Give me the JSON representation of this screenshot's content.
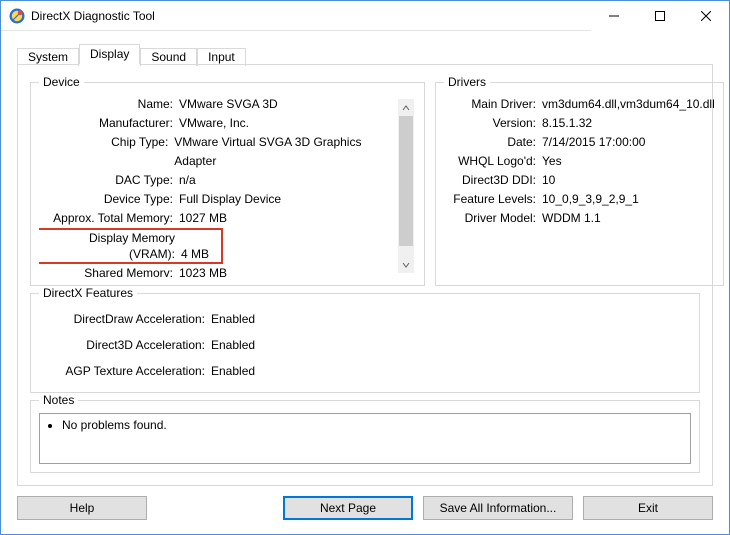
{
  "window": {
    "title": "DirectX Diagnostic Tool"
  },
  "tabs": {
    "system": "System",
    "display": "Display",
    "sound": "Sound",
    "input": "Input",
    "active": "display"
  },
  "groups": {
    "device": "Device",
    "drivers": "Drivers",
    "dxfeat": "DirectX Features",
    "notes": "Notes"
  },
  "device": {
    "name_k": "Name:",
    "name_v": "VMware SVGA 3D",
    "manufacturer_k": "Manufacturer:",
    "manufacturer_v": "VMware, Inc.",
    "chip_k": "Chip Type:",
    "chip_v": "VMware Virtual SVGA 3D Graphics Adapter",
    "dac_k": "DAC Type:",
    "dac_v": "n/a",
    "devtype_k": "Device Type:",
    "devtype_v": "Full Display Device",
    "totmem_k": "Approx. Total Memory:",
    "totmem_v": "1027 MB",
    "vram_k": "Display Memory (VRAM):",
    "vram_v": "4 MB",
    "shmem_k": "Shared Memory:",
    "shmem_v": "1023 MB"
  },
  "drivers": {
    "main_k": "Main Driver:",
    "main_v": "vm3dum64.dll,vm3dum64_10.dll",
    "ver_k": "Version:",
    "ver_v": "8.15.1.32",
    "date_k": "Date:",
    "date_v": "7/14/2015 17:00:00",
    "whql_k": "WHQL Logo'd:",
    "whql_v": "Yes",
    "ddi_k": "Direct3D DDI:",
    "ddi_v": "10",
    "feat_k": "Feature Levels:",
    "feat_v": "10_0,9_3,9_2,9_1",
    "model_k": "Driver Model:",
    "model_v": "WDDM 1.1"
  },
  "dxfeat": {
    "dd_k": "DirectDraw Acceleration:",
    "dd_v": "Enabled",
    "d3d_k": "Direct3D Acceleration:",
    "d3d_v": "Enabled",
    "agp_k": "AGP Texture Acceleration:",
    "agp_v": "Enabled"
  },
  "notes": {
    "item0": "No problems found."
  },
  "buttons": {
    "help": "Help",
    "next": "Next Page",
    "save": "Save All Information...",
    "exit": "Exit"
  }
}
